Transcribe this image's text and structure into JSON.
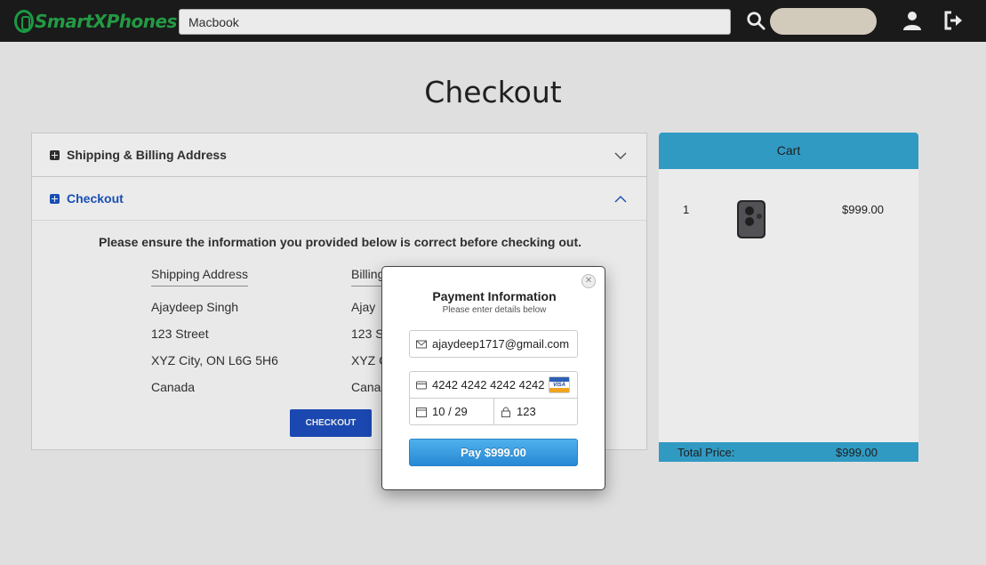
{
  "header": {
    "logo_text": "SmartXPhones",
    "search_value": "Macbook",
    "cart_label": "Cart"
  },
  "page": {
    "title": "Checkout"
  },
  "accordion": {
    "shipping_title": "Shipping & Billing Address",
    "checkout_title": "Checkout",
    "ensure_text": "Please ensure the information you provided below is correct before checking out.",
    "shipping": {
      "header": "Shipping Address",
      "name": "Ajaydeep Singh",
      "street": "123 Street",
      "city": "XYZ City, ON L6G 5H6",
      "country": "Canada"
    },
    "billing": {
      "header": "Billing",
      "name": "Ajay",
      "street": "123 S",
      "city": "XYZ C",
      "country": "Canad"
    },
    "checkout_button": "CHECKOUT"
  },
  "cart": {
    "title": "Cart",
    "items": [
      {
        "qty": "1",
        "price": "$999.00"
      }
    ],
    "total_label": "Total Price:",
    "total_value": "$999.00"
  },
  "modal": {
    "title": "Payment Information",
    "subtitle": "Please enter details below",
    "email": "ajaydeep1717@gmail.com",
    "card_number": "4242 4242 4242 4242",
    "expiry": "10 / 29",
    "cvc": "123",
    "card_brand": "VISA",
    "pay_label": "Pay $999.00"
  },
  "colors": {
    "accent": "#35a8d4",
    "brand": "#27a84a",
    "checkout_blue": "#1d4fbf"
  }
}
